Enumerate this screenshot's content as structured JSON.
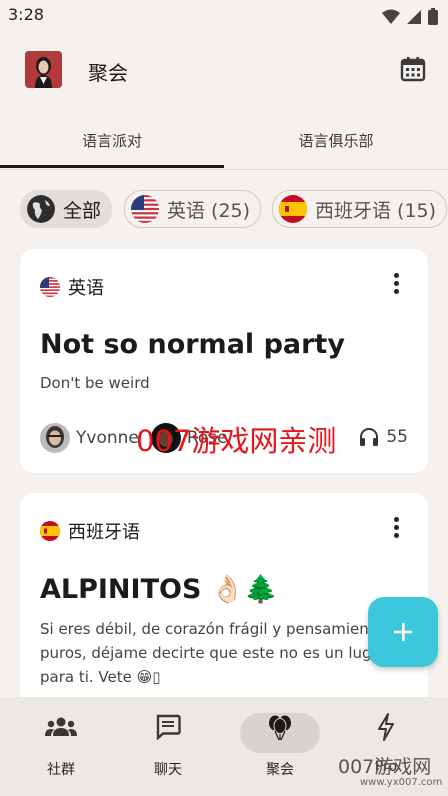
{
  "status": {
    "time": "3:28"
  },
  "header": {
    "title": "聚会"
  },
  "tabs": [
    {
      "label": "语言派对"
    },
    {
      "label": "语言俱乐部"
    }
  ],
  "chips": [
    {
      "label": "全部"
    },
    {
      "label": "英语 (25)"
    },
    {
      "label": "西班牙语 (15)"
    }
  ],
  "cards": [
    {
      "language": "英语",
      "title": "Not so normal party",
      "description": "Don't be weird",
      "people": [
        {
          "name": "Yvonne"
        },
        {
          "name": "Rose"
        }
      ],
      "listeners": "55"
    },
    {
      "language": "西班牙语",
      "title": "ALPINITOS 👌🏻🌲",
      "description_lines": [
        " Si eres débil, de corazón frágil y pensamien",
        "puros, déjame decirte que este no es un lug",
        "para ti. Vete 😁▯"
      ]
    }
  ],
  "watermark": {
    "text": "007游戏网亲测",
    "site": "007游戏网",
    "url": "www.yx007.com"
  },
  "bottom_nav": [
    {
      "label": "社群"
    },
    {
      "label": "聊天"
    },
    {
      "label": "聚会"
    },
    {
      "label": "Pro"
    }
  ],
  "colors": {
    "accent": "#3dc7dc",
    "background": "#f4f1ee",
    "watermark": "#e8141b"
  }
}
